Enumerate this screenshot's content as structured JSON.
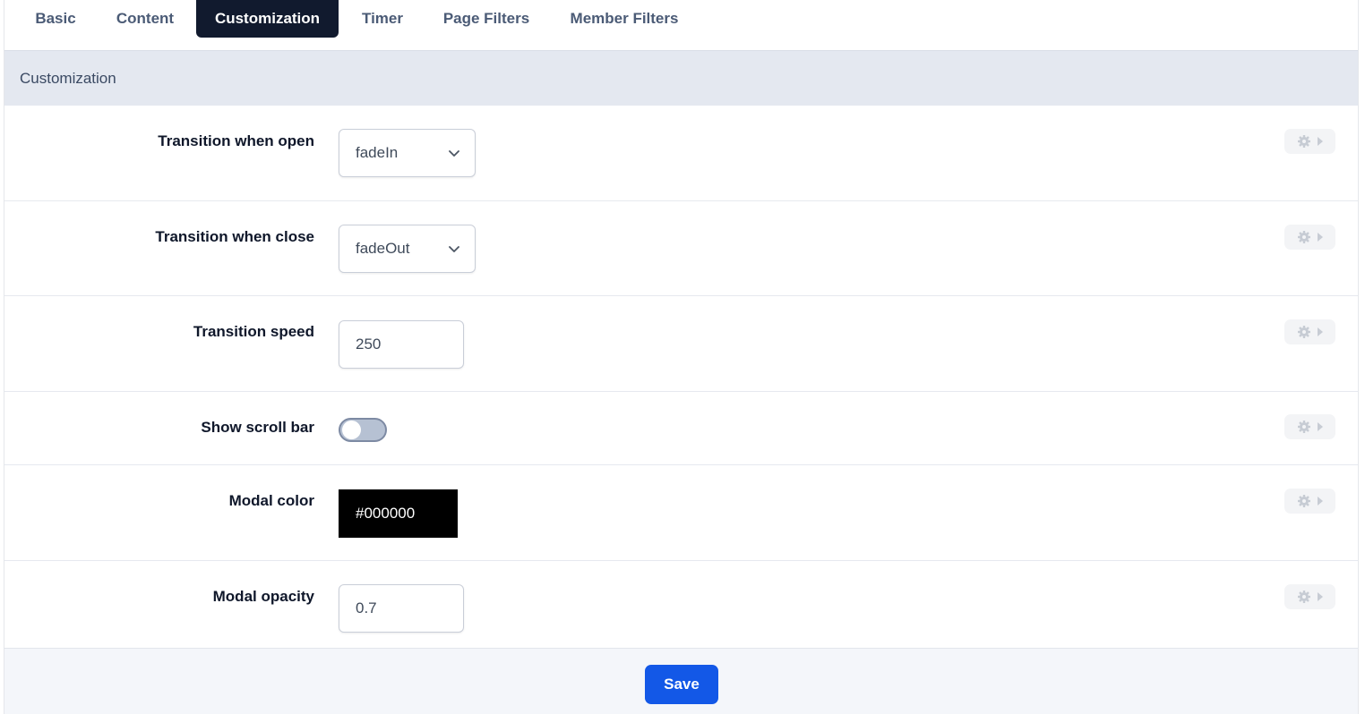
{
  "tabs": [
    {
      "label": "Basic",
      "active": false
    },
    {
      "label": "Content",
      "active": false
    },
    {
      "label": "Customization",
      "active": true
    },
    {
      "label": "Timer",
      "active": false
    },
    {
      "label": "Page Filters",
      "active": false
    },
    {
      "label": "Member Filters",
      "active": false
    }
  ],
  "section": {
    "title": "Customization"
  },
  "fields": {
    "transition_open": {
      "label": "Transition when open",
      "value": "fadeIn"
    },
    "transition_close": {
      "label": "Transition when close",
      "value": "fadeOut"
    },
    "transition_speed": {
      "label": "Transition speed",
      "value": "250"
    },
    "show_scroll_bar": {
      "label": "Show scroll bar",
      "enabled": false
    },
    "modal_color": {
      "label": "Modal color",
      "value": "#000000"
    },
    "modal_opacity": {
      "label": "Modal opacity",
      "value": "0.7"
    }
  },
  "row_action_icons": [
    "gear-icon",
    "caret-right-icon"
  ],
  "footer": {
    "save_label": "Save"
  },
  "colors": {
    "active_tab_bg": "#111a2e",
    "section_header_bg": "#e4e8f0",
    "save_button_bg": "#1358e7",
    "toggle_off_bg": "#b6c1d3"
  }
}
